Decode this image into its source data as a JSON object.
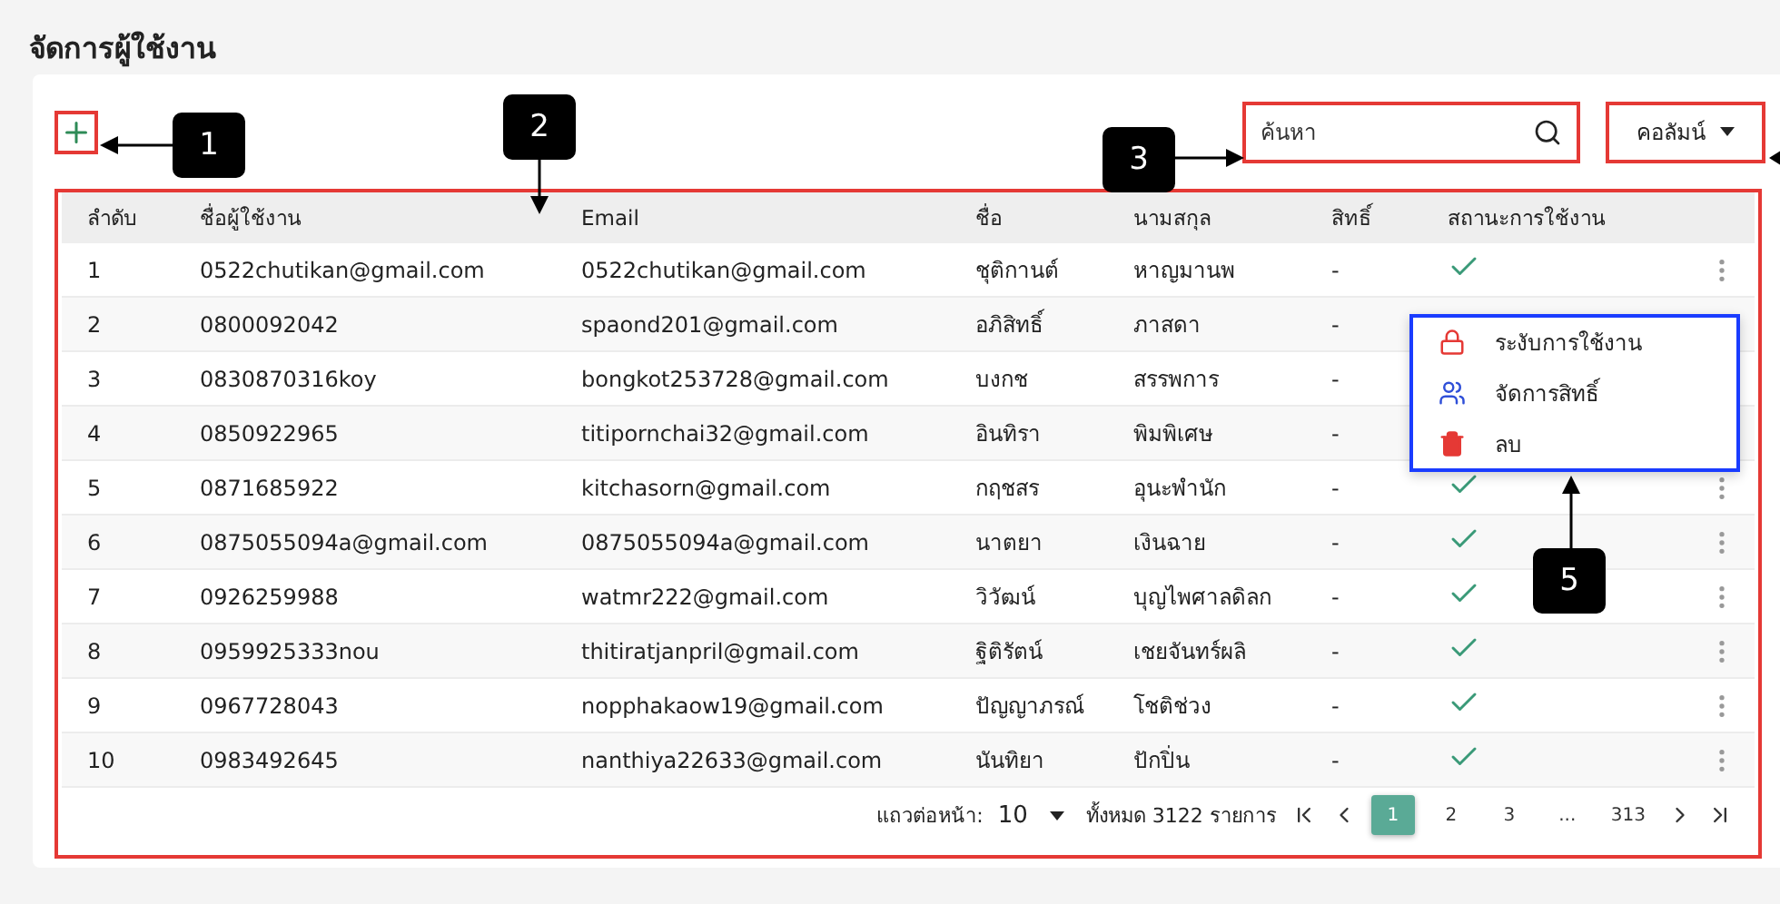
{
  "title": "จัดการผู้ใช้งาน",
  "search": {
    "placeholder": "ค้นหา"
  },
  "column_button": {
    "label": "คอลัมน์"
  },
  "table": {
    "columns": [
      "ลำดับ",
      "ชื่อผู้ใช้งาน",
      "Email",
      "ชื่อ",
      "นามสกุล",
      "สิทธิ์",
      "สถานะการใช้งาน"
    ],
    "rows": [
      {
        "cells": [
          "1",
          "0522chutikan@gmail.com",
          "0522chutikan@gmail.com",
          "ชุติกานต์",
          "หาญมานพ",
          "-"
        ],
        "active": true
      },
      {
        "cells": [
          "2",
          "0800092042",
          "spaond201@gmail.com",
          "อภิสิทธิ์",
          "ภาสดา",
          "-"
        ]
      },
      {
        "cells": [
          "3",
          "0830870316koy",
          "bongkot253728@gmail.com",
          "บงกช",
          "สรรพการ",
          "-"
        ]
      },
      {
        "cells": [
          "4",
          "0850922965",
          "titipornchai32@gmail.com",
          "อินทิรา",
          "พิมพิเศษ",
          "-"
        ]
      },
      {
        "cells": [
          "5",
          "0871685922",
          "kitchasorn@gmail.com",
          "กฤชสร",
          "อุนะพำนัก",
          "-"
        ],
        "active": true
      },
      {
        "cells": [
          "6",
          "0875055094a@gmail.com",
          "0875055094a@gmail.com",
          "นาตยา",
          "เงินฉาย",
          "-"
        ],
        "active": true
      },
      {
        "cells": [
          "7",
          "0926259988",
          "watmr222@gmail.com",
          "วิวัฒน์",
          "บุญไพศาลดิลก",
          "-"
        ],
        "active": true
      },
      {
        "cells": [
          "8",
          "0959925333nou",
          "thitiratjanpril@gmail.com",
          "ฐิติรัตน์",
          "เชยจันทร์ผลิ",
          "-"
        ],
        "active": true
      },
      {
        "cells": [
          "9",
          "0967728043",
          "nopphakaow19@gmail.com",
          "ปัญญาภรณ์",
          "โชติช่วง",
          "-"
        ],
        "active": true
      },
      {
        "cells": [
          "10",
          "0983492645",
          "nanthiya22633@gmail.com",
          "นันทิยา",
          "ปักปิ่น",
          "-"
        ],
        "active": true
      }
    ]
  },
  "row_menu": {
    "open": true,
    "items": [
      {
        "kind": "suspend",
        "label": "ระงับการใช้งาน"
      },
      {
        "kind": "permissions",
        "label": "จัดการสิทธิ์"
      },
      {
        "kind": "delete",
        "label": "ลบ"
      }
    ]
  },
  "pagination": {
    "rows_per_page_label": "แถวต่อหน้า:",
    "rows_per_page": "10",
    "total": "ทั้งหมด 3122 รายการ",
    "pages": [
      {
        "label": "1",
        "selected": true
      },
      {
        "label": "2",
        "selected": false
      },
      {
        "label": "3",
        "selected": false
      },
      {
        "label": "...",
        "selected": false
      },
      {
        "label": "313",
        "selected": false
      }
    ]
  },
  "callouts": [
    "1",
    "2",
    "3",
    "5"
  ]
}
